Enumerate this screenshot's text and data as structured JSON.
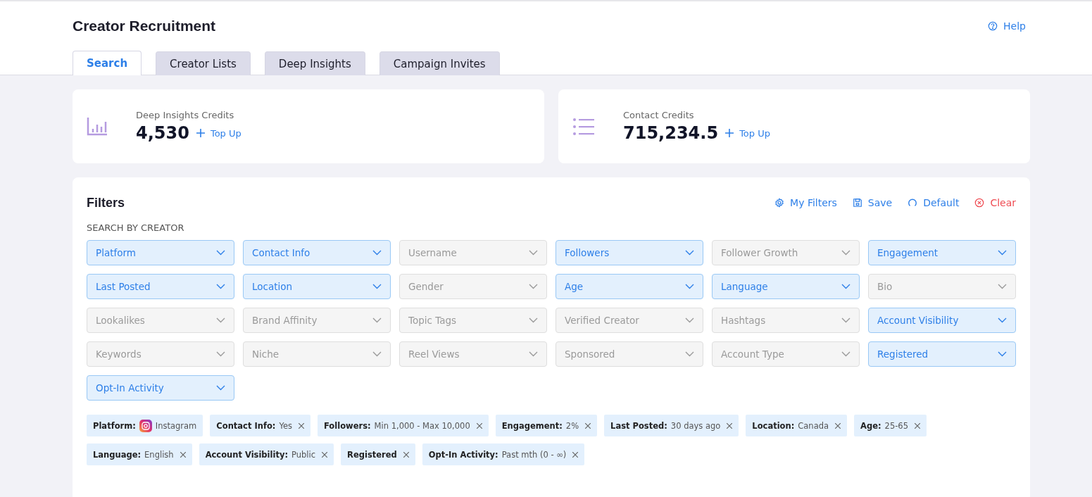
{
  "page": {
    "title": "Creator Recruitment",
    "help": "Help"
  },
  "tabs": [
    {
      "label": "Search",
      "selected": true
    },
    {
      "label": "Creator Lists",
      "selected": false
    },
    {
      "label": "Deep Insights",
      "selected": false
    },
    {
      "label": "Campaign Invites",
      "selected": false
    }
  ],
  "credits": [
    {
      "kind": "chart",
      "label": "Deep Insights Credits",
      "value": "4,530",
      "action": "Top Up"
    },
    {
      "kind": "list",
      "label": "Contact Credits",
      "value": "715,234.5",
      "action": "Top Up"
    }
  ],
  "filters": {
    "title": "Filters",
    "actions": [
      {
        "kind": "gear",
        "label": "My Filters"
      },
      {
        "kind": "save",
        "label": "Save"
      },
      {
        "kind": "default",
        "label": "Default"
      },
      {
        "kind": "clear",
        "label": "Clear"
      }
    ],
    "section": "SEARCH BY CREATOR",
    "dropdowns": [
      {
        "label": "Platform",
        "active": true
      },
      {
        "label": "Contact Info",
        "active": true
      },
      {
        "label": "Username",
        "active": false
      },
      {
        "label": "Followers",
        "active": true
      },
      {
        "label": "Follower Growth",
        "active": false
      },
      {
        "label": "Engagement",
        "active": true
      },
      {
        "label": "Last Posted",
        "active": true
      },
      {
        "label": "Location",
        "active": true
      },
      {
        "label": "Gender",
        "active": false
      },
      {
        "label": "Age",
        "active": true
      },
      {
        "label": "Language",
        "active": true
      },
      {
        "label": "Bio",
        "active": false
      },
      {
        "label": "Lookalikes",
        "active": false
      },
      {
        "label": "Brand Affinity",
        "active": false
      },
      {
        "label": "Topic Tags",
        "active": false
      },
      {
        "label": "Verified Creator",
        "active": false
      },
      {
        "label": "Hashtags",
        "active": false
      },
      {
        "label": "Account Visibility",
        "active": true
      },
      {
        "label": "Keywords",
        "active": false
      },
      {
        "label": "Niche",
        "active": false
      },
      {
        "label": "Reel Views",
        "active": false
      },
      {
        "label": "Sponsored",
        "active": false
      },
      {
        "label": "Account Type",
        "active": false
      },
      {
        "label": "Registered",
        "active": true
      },
      {
        "label": "Opt-In Activity",
        "active": true
      }
    ],
    "chips": [
      {
        "kind": "platform",
        "label": "Platform:",
        "value": "Instagram",
        "removable": false
      },
      {
        "kind": "text",
        "label": "Contact Info:",
        "value": "Yes",
        "removable": true
      },
      {
        "kind": "text",
        "label": "Followers:",
        "value": "Min 1,000 - Max 10,000",
        "removable": true
      },
      {
        "kind": "text",
        "label": "Engagement:",
        "value": "2%",
        "removable": true
      },
      {
        "kind": "text",
        "label": "Last Posted:",
        "value": "30 days ago",
        "removable": true
      },
      {
        "kind": "text",
        "label": "Location:",
        "value": "Canada",
        "removable": true
      },
      {
        "kind": "text",
        "label": "Age:",
        "value": "25-65",
        "removable": true
      },
      {
        "kind": "text",
        "label": "Language:",
        "value": "English",
        "removable": true
      },
      {
        "kind": "text",
        "label": "Account Visibility:",
        "value": "Public",
        "removable": true
      },
      {
        "kind": "text",
        "label": "Registered",
        "removable": true
      },
      {
        "kind": "text",
        "label": "Opt-In Activity:",
        "value": "Past mth (0 - ∞)",
        "removable": true
      }
    ]
  }
}
